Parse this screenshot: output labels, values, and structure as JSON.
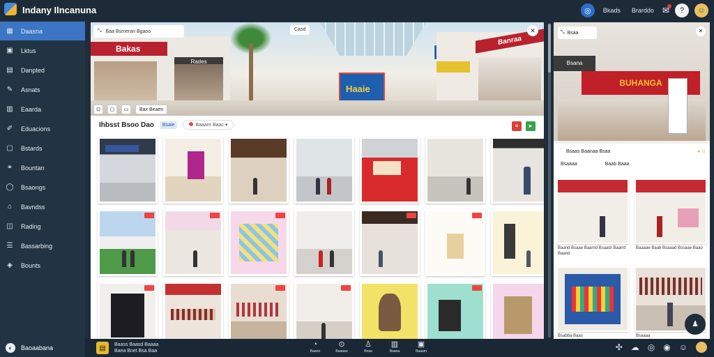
{
  "app": {
    "title": "Indany Ilncanuna"
  },
  "header": {
    "chip1": "Bkads",
    "chip2": "Brarddo",
    "icons": [
      "globe-icon",
      "chat-icon",
      "bell-icon",
      "help-icon",
      "user-avatar"
    ]
  },
  "sidebar": {
    "items": [
      {
        "label": "Daasna",
        "icon": "dashboard-icon",
        "active": true
      },
      {
        "label": "Lktus",
        "icon": "grid-icon"
      },
      {
        "label": "Danpted",
        "icon": "document-icon"
      },
      {
        "label": "Asnats",
        "icon": "pen-icon"
      },
      {
        "label": "Eaarda",
        "icon": "calendar-icon"
      },
      {
        "label": "Eduacions",
        "icon": "edit-icon"
      },
      {
        "label": "Bstards",
        "icon": "box-icon"
      },
      {
        "label": "Bountan",
        "icon": "link-icon"
      },
      {
        "label": "Bsaongs",
        "icon": "globe-icon"
      },
      {
        "label": "Bavndss",
        "icon": "store-icon"
      },
      {
        "label": "Rading",
        "icon": "tag-icon"
      },
      {
        "label": "Bassarbing",
        "icon": "list-icon"
      },
      {
        "label": "Bounts",
        "icon": "shield-icon"
      }
    ]
  },
  "hero": {
    "toolbar_text": "Baa Bsmeran Bgaoo",
    "pill_text": "Casd",
    "store_sign": "Bakas",
    "banner_text": "Haaie",
    "right_sign": "Banraa",
    "left_sign2": "Rades"
  },
  "filters": {
    "chip_label": "Bax Beaen"
  },
  "gallery": {
    "title": "Ihbsst Bsoo Dao",
    "tag": "Bsaie",
    "sort_label": "Baaare Baac"
  },
  "right_panel": {
    "toolbar_text": "Bsaa",
    "hero_sign": "BUHANGA",
    "hero_top_sign": "Bsana",
    "card_head": "Bsaas Baanaa Bsaa",
    "card_sub_left": "Bsaaaa",
    "card_sub_right": "Baab Baaa",
    "tiles": [
      {
        "caption": "Baand Bsaae Baarnd Bsaadr Baarrd Baand"
      },
      {
        "caption": "Baaaae Baab Bsaaad Bssaae Baao"
      },
      {
        "caption": "Bsabba Baas"
      },
      {
        "caption": "Bsaaaa"
      }
    ]
  },
  "bottom": {
    "user_label": "Baoaabana",
    "status_line1": "Baass Baasd Baaaa",
    "status_line2": "Baea Bnet Bsa Baa",
    "tools": [
      {
        "label": "Baano",
        "icon": "clock-icon"
      },
      {
        "label": "Baaaao",
        "icon": "pin-icon"
      },
      {
        "label": "Boaa",
        "icon": "person-icon"
      },
      {
        "label": "Baaoa",
        "icon": "chart-icon"
      },
      {
        "label": "Baaam",
        "icon": "list-icon"
      }
    ]
  },
  "colors": {
    "topbar": "#1d2b38",
    "sidebar": "#223444",
    "accent": "#3b75c4",
    "brand_red": "#b8222e",
    "status_gold": "#e6b930"
  }
}
